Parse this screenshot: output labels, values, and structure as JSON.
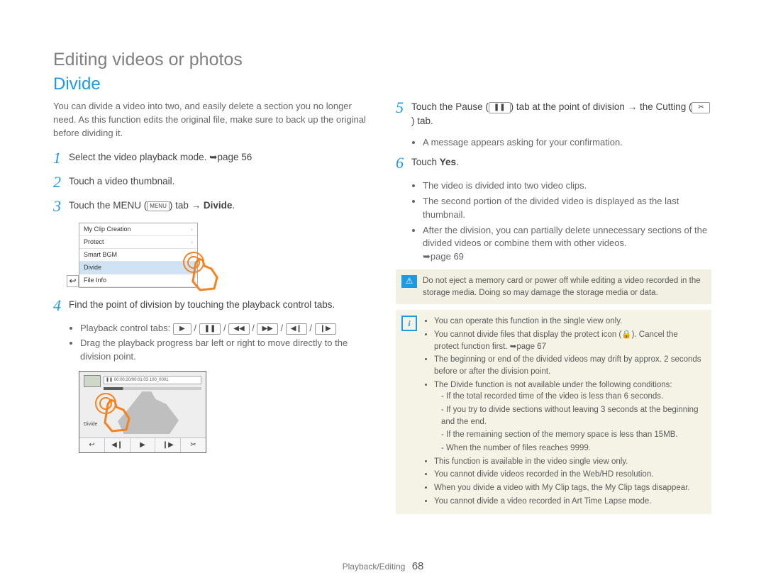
{
  "page_title": "Editing videos or photos",
  "section_title": "Divide",
  "intro": "You can divide a video into two, and easily delete a section you no longer need. As this function edits the original file, make sure to back up the original before dividing it.",
  "steps": {
    "s1": {
      "num": "1",
      "body_before": "Select the video playback mode. ",
      "page_ref": "page 56"
    },
    "s2": {
      "num": "2",
      "body": "Touch a video thumbnail."
    },
    "s3": {
      "num": "3",
      "body_before": "Touch the MENU (",
      "menu_label": "MENU",
      "body_mid": ") tab → ",
      "body_bold": "Divide",
      "body_after": "."
    },
    "s4": {
      "num": "4",
      "body": "Find the point of division by touching the playback control tabs.",
      "sub1_label": "Playback control tabs: ",
      "icons": [
        "▶",
        "❚❚",
        "◀◀",
        "▶▶",
        "◀❙",
        "❙▶"
      ],
      "sub2": "Drag the playback progress bar left or right to move directly to the division point."
    },
    "s5": {
      "num": "5",
      "body_before": "Touch the Pause (",
      "pause_icon": "❚❚",
      "body_mid1": ") tab at the point of division → the Cutting (",
      "cut_icon": "✂",
      "body_after": ") tab.",
      "sub1": "A message appears asking for your confirmation."
    },
    "s6": {
      "num": "6",
      "body_before": "Touch ",
      "body_bold": "Yes",
      "body_after": ".",
      "sub1": "The video is divided into two video clips.",
      "sub2": "The second portion of the divided video is displayed as the last thumbnail.",
      "sub3_before": "After the division, you can partially delete unnecessary sections of the divided videos or combine them with other videos. ",
      "sub3_ref": "page 69"
    }
  },
  "menu_panel": {
    "items": [
      "My Clip Creation",
      "Protect",
      "Smart BGM",
      "Divide",
      "File Info"
    ],
    "selected_index": 3,
    "return_label": "↩"
  },
  "player": {
    "timecode": "❚❚ 00:00:20/00:01:03  100_0001",
    "divide_label": "Divide",
    "controls": [
      "↩",
      "◀❙",
      "▶",
      "❙▶",
      "✂"
    ]
  },
  "callouts": {
    "warn": {
      "icon": "⚠",
      "text": "Do not eject a memory card or power off while editing a video recorded in the storage media. Doing so may damage the storage media or data."
    },
    "info": {
      "icon": "i",
      "b1": "You can operate this function in the single view only.",
      "b2_before": "You cannot divide files that display the protect icon (",
      "b2_lock": "🔒",
      "b2_mid": "). Cancel the protect function first. ",
      "b2_ref": "page 67",
      "b3": "The beginning or end of the divided videos may drift by approx. 2 seconds before or after the division point.",
      "b4": "The Divide function is not available under the following conditions:",
      "b4a": "- If the total recorded time of the video is less than 6 seconds.",
      "b4b": "- If you try to divide sections without leaving 3 seconds at the beginning and the end.",
      "b4c": "- If the remaining section of the memory space is less than 15MB.",
      "b4d": "- When the number of files reaches 9999.",
      "b5": "This function is available in the video single view only.",
      "b6": "You cannot divide videos recorded in the Web/HD resolution.",
      "b7": "When you divide a video with My Clip tags, the My Clip tags disappear.",
      "b8": "You cannot divide a video recorded in Art Time Lapse mode."
    }
  },
  "footer": {
    "section": "Playback/Editing",
    "page": "68"
  }
}
